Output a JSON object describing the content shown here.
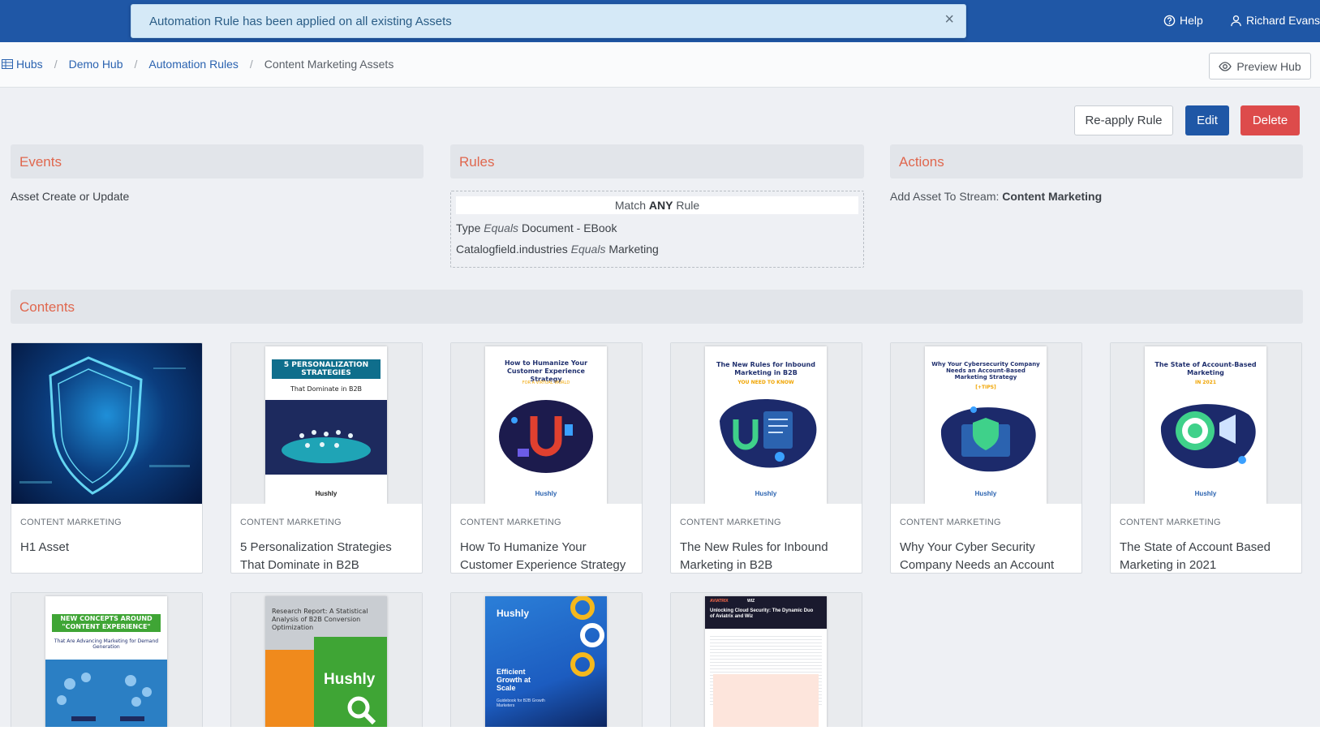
{
  "toast": {
    "message": "Automation Rule has been applied on all existing Assets",
    "close": "×"
  },
  "nav": {
    "help": "Help",
    "user": "Richard Evans"
  },
  "breadcrumb": {
    "hubs": "Hubs",
    "demo_hub": "Demo Hub",
    "automation_rules": "Automation Rules",
    "current": "Content Marketing Assets",
    "sep": "/"
  },
  "preview_hub": "Preview Hub",
  "buttons": {
    "reapply": "Re-apply Rule",
    "edit": "Edit",
    "delete": "Delete"
  },
  "events": {
    "heading": "Events",
    "value": "Asset Create or Update"
  },
  "rules": {
    "heading": "Rules",
    "match_prefix": "Match",
    "match_mode": "ANY",
    "match_suffix": "Rule",
    "conditions": [
      {
        "field": "Type",
        "operator": "Equals",
        "value": "Document - EBook"
      },
      {
        "field": "Catalogfield.industries",
        "operator": "Equals",
        "value": "Marketing"
      }
    ]
  },
  "actions": {
    "heading": "Actions",
    "label": "Add Asset To Stream:",
    "value": "Content Marketing"
  },
  "contents": {
    "heading": "Contents",
    "cards": [
      {
        "category": "CONTENT MARKETING",
        "title": "H1 Asset"
      },
      {
        "category": "CONTENT MARKETING",
        "title": "5 Personalization Strategies That Dominate in B2B",
        "cover_title": "5 PERSONALIZATION STRATEGIES",
        "cover_sub": "That Dominate in B2B",
        "brand": "Hushly"
      },
      {
        "category": "CONTENT MARKETING",
        "title": "How To Humanize Your Customer Experience Strategy",
        "cover_title": "How to Humanize Your Customer Experience Strategy",
        "cover_sub": "FOR A VIRTUAL WORLD",
        "brand": "Hushly"
      },
      {
        "category": "CONTENT MARKETING",
        "title": "The New Rules for Inbound Marketing in B2B",
        "cover_title": "The New Rules for Inbound Marketing in B2B",
        "cover_sub": "YOU NEED TO KNOW",
        "brand": "Hushly"
      },
      {
        "category": "CONTENT MARKETING",
        "title": "Why Your Cyber Security Company Needs an Account",
        "cover_title": "Why Your Cybersecurity Company Needs an Account-Based Marketing Strategy",
        "cover_sub": "[+TIPS]",
        "brand": "Hushly"
      },
      {
        "category": "CONTENT MARKETING",
        "title": "The State of Account Based Marketing in 2021",
        "cover_title": "The State of Account-Based Marketing",
        "cover_sub": "IN 2021",
        "brand": "Hushly"
      },
      {
        "cover_title": "NEW CONCEPTS AROUND \"CONTENT EXPERIENCE\"",
        "cover_sub": "That Are Advancing Marketing for Demand Generation"
      },
      {
        "cover_title": "Research Report: A Statistical Analysis of B2B Conversion Optimization",
        "brand": "Hushly"
      },
      {
        "brand": "Hushly",
        "cover_title": "Efficient Growth at Scale",
        "cover_sub": "Guidebook for B2B Growth Marketers"
      },
      {
        "cover_title": "Unlocking Cloud Security: The Dynamic Duo of Aviatrix and Wiz",
        "brand_left": "AVIATRIX",
        "brand_right": "WIZ"
      }
    ]
  },
  "colors": {
    "navbar": "#1f57a6",
    "accent_heading": "#e0674e",
    "edit": "#1f57a6",
    "delete": "#dd4b4b",
    "toast_bg": "#d5e9f7"
  },
  "icons": {
    "help": "question-circle-icon",
    "user": "user-icon",
    "hubs": "grid-icon",
    "preview": "eye-icon",
    "close": "close-icon"
  }
}
